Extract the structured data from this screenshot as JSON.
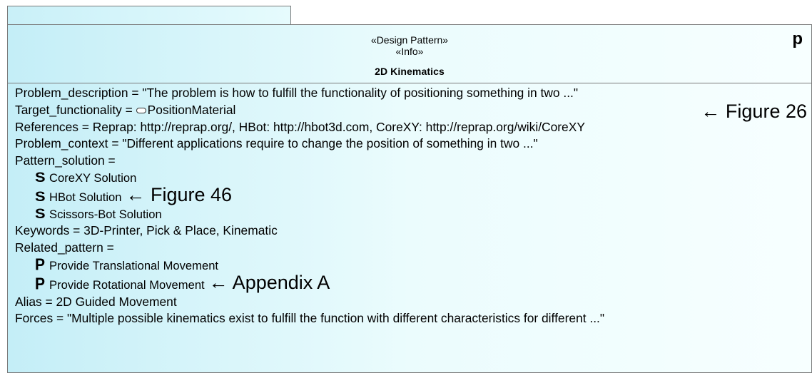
{
  "element": {
    "stereotypes": [
      "«Design Pattern»",
      "«Info»"
    ],
    "name": "2D Kinematics",
    "type_letter": "p"
  },
  "rows": {
    "problem_description": "Problem_description = \"The problem is how to fulfill the functionality of positioning something in two ...\"",
    "target_functionality_label": "Target_functionality = ",
    "target_functionality_value": "PositionMaterial",
    "references": "References = Reprap: http://reprap.org/, HBot: http://hbot3d.com, CoreXY: http://reprap.org/wiki/CoreXY",
    "problem_context": "Problem_context = \"Different applications require to change the position of something in two ...\"",
    "pattern_solution": "Pattern_solution =",
    "solutions": [
      {
        "icon": "S",
        "label": "CoreXY Solution"
      },
      {
        "icon": "S",
        "label": "HBot Solution"
      },
      {
        "icon": "S",
        "label": "Scissors-Bot Solution"
      }
    ],
    "keywords": "Keywords = 3D-Printer, Pick & Place, Kinematic",
    "related_pattern": "Related_pattern =",
    "related": [
      {
        "icon": "P",
        "label": "Provide Translational Movement"
      },
      {
        "icon": "P",
        "label": "Provide Rotational Movement"
      }
    ],
    "alias": "Alias = 2D Guided Movement",
    "forces": "Forces = \"Multiple possible kinematics exist to fulfill the function with different characteristics for different ...\""
  },
  "annotations": {
    "figure26": "← Figure 26",
    "figure46": "← Figure 46",
    "appendixA": "← Appendix A"
  }
}
